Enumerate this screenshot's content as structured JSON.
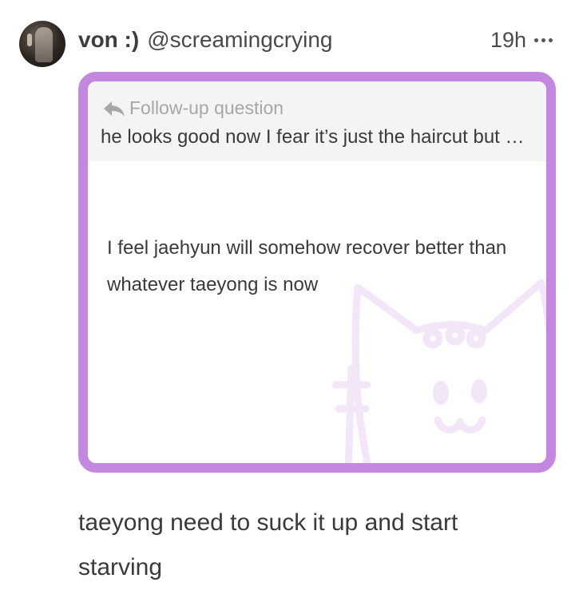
{
  "post": {
    "display_name": "von :)",
    "handle": "@screamingcrying",
    "time": "19h"
  },
  "card": {
    "followup_label": "Follow-up question",
    "followup_text": "he looks good now I fear it’s just the haircut but s…",
    "answer_text": "I feel jaehyun will somehow recover better than whatever taeyong is now",
    "border_color": "#c487e0"
  },
  "caption": "taeyong need to suck it up and start starving",
  "icons": {
    "reply": "reply-arrow-icon",
    "more": "more-horizontal-icon",
    "decoration": "cat-doodle"
  }
}
